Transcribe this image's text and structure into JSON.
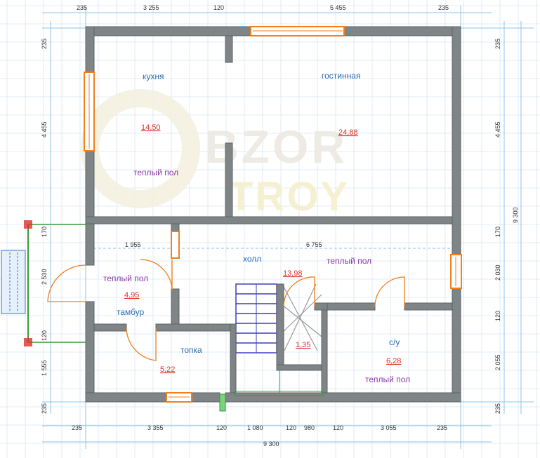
{
  "colors": {
    "wall": "#7f8487",
    "wall_edge": "#5d6366",
    "window": "#f07f1e",
    "grid": "#d7e6f3",
    "dim_line": "#8fc3e8",
    "room_label": "#2a6fb6",
    "heat_label": "#8a3aa8",
    "area_label": "#e0302a",
    "stair": "#3d3dbd",
    "watermark": "#f4f1e1"
  },
  "watermark": {
    "line1": "BZOR",
    "line2": "TROY"
  },
  "rooms": {
    "kitchen": {
      "name": "кухня",
      "area": "14,50",
      "floor": "теплый пол"
    },
    "living": {
      "name": "гостинная",
      "area": "24,88"
    },
    "hall": {
      "name": "холл",
      "area": "13,98",
      "floor": "теплый пол"
    },
    "vestibule": {
      "name": "тамбур",
      "area": "4,95",
      "floor": "теплый пол"
    },
    "boiler": {
      "name": "топка",
      "area": "5,22"
    },
    "bath": {
      "name": "с/у",
      "area": "6,28",
      "floor": "теплый пол"
    },
    "closet": {
      "area": "1,35"
    }
  },
  "dimensions": {
    "top": [
      "235",
      "3 255",
      "120",
      "5 455",
      "235"
    ],
    "bottom": [
      "235",
      "3 355",
      "120",
      "1 080",
      "120",
      "980",
      "120",
      "3 055",
      "235"
    ],
    "bottom_total": "9 300",
    "left": [
      "235",
      "4 455",
      "170",
      "2 530",
      "120",
      "1 555",
      "235"
    ],
    "right": [
      "235",
      "4 455",
      "170",
      "2 030",
      "120",
      "2 055",
      "235"
    ],
    "right_total": "9 300",
    "inner": [
      "1 955",
      "6 755"
    ]
  }
}
